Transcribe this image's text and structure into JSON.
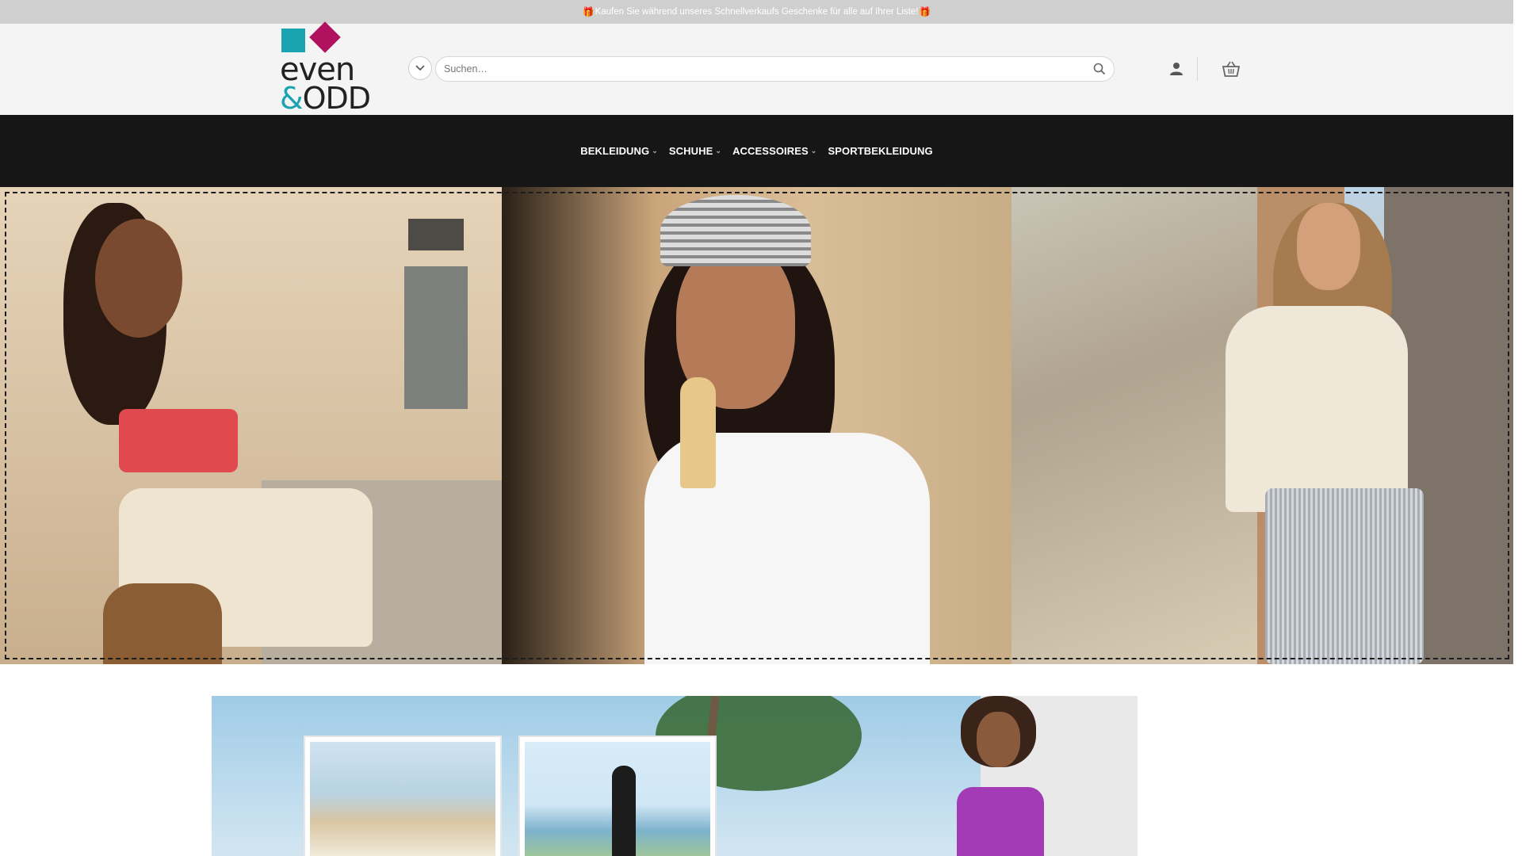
{
  "promo": {
    "icon_left": "gift-icon",
    "text": "Kaufen Sie während unseres Schnellverkaufs Geschenke für alle auf Ihrer Liste!",
    "icon_right": "gift-icon",
    "gift_glyph": "🎁"
  },
  "header": {
    "logo": {
      "line1": "even",
      "line2_amp": "&",
      "line2": "ODD"
    },
    "search": {
      "placeholder": "Suchen…",
      "value": ""
    },
    "icons": [
      "chevron-down-icon",
      "search-icon",
      "user-icon",
      "basket-icon"
    ]
  },
  "nav": {
    "items": [
      {
        "label": "BEKLEIDUNG",
        "has_dropdown": true
      },
      {
        "label": "SCHUHE",
        "has_dropdown": true
      },
      {
        "label": "ACCESSOIRES",
        "has_dropdown": true
      },
      {
        "label": "SPORTBEKLEIDUNG",
        "has_dropdown": false
      }
    ]
  },
  "colors": {
    "promo_bg": "#cfcfcf",
    "header_bg": "#f4f4f4",
    "nav_bg": "#161616",
    "logo_teal": "#1aa3b0",
    "logo_magenta": "#b0125f"
  }
}
